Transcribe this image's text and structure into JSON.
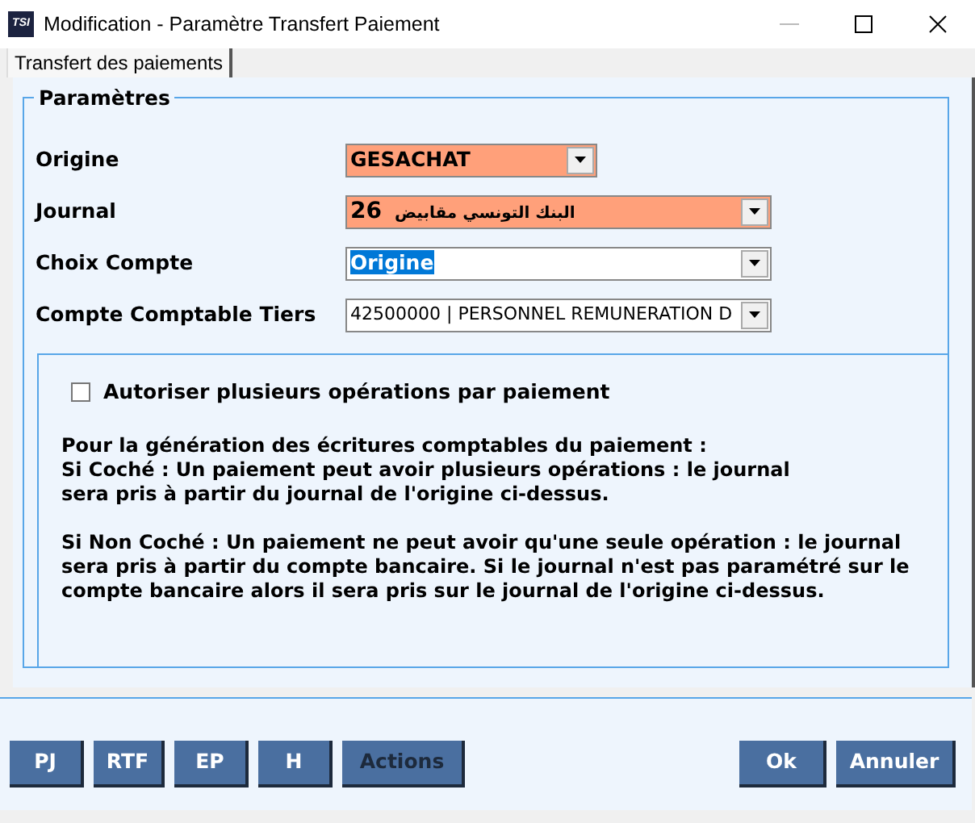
{
  "window": {
    "title": "Modification - Paramètre Transfert Paiement",
    "icon_text": "TSI"
  },
  "tabs": [
    {
      "label": "Transfert des paiements",
      "selected": true
    }
  ],
  "group": {
    "title": "Paramètres",
    "fields": [
      {
        "label": "Origine",
        "value": "GESACHAT",
        "required": true,
        "text_selected": false,
        "kind": "short"
      },
      {
        "label": "Journal",
        "code": "26",
        "value": "البنك التونسي مقابيض",
        "required": true,
        "text_selected": false,
        "kind": "journal"
      },
      {
        "label": "Choix Compte",
        "value": "Origine",
        "required": false,
        "text_selected": true,
        "kind": "long"
      },
      {
        "label": "Compte Comptable Tiers",
        "value": "42500000 | PERSONNEL REMUNERATION D",
        "required": false,
        "text_selected": false,
        "kind": "plain"
      }
    ]
  },
  "option": {
    "label": "Autoriser plusieurs opérations par paiement",
    "checked": false
  },
  "notes": [
    "Pour la génération des écritures comptables du paiement :\nSi Coché : Un paiement peut avoir plusieurs opérations : le journal\nsera pris à partir du journal de l'origine ci-dessus.",
    "Si Non Coché : Un paiement ne peut avoir qu'une seule opération : le journal\nsera pris à partir du compte bancaire. Si le journal n'est pas paramétré sur le\ncompte bancaire alors il sera pris sur le journal de l'origine ci-dessus."
  ],
  "buttons_left": [
    {
      "label": "PJ",
      "disabled": false
    },
    {
      "label": "RTF",
      "disabled": false
    },
    {
      "label": "EP",
      "disabled": false
    },
    {
      "label": "H",
      "disabled": false
    },
    {
      "label": "Actions",
      "disabled": true
    }
  ],
  "buttons_right": [
    {
      "label": "Ok",
      "disabled": false
    },
    {
      "label": "Annuler",
      "disabled": false
    }
  ]
}
